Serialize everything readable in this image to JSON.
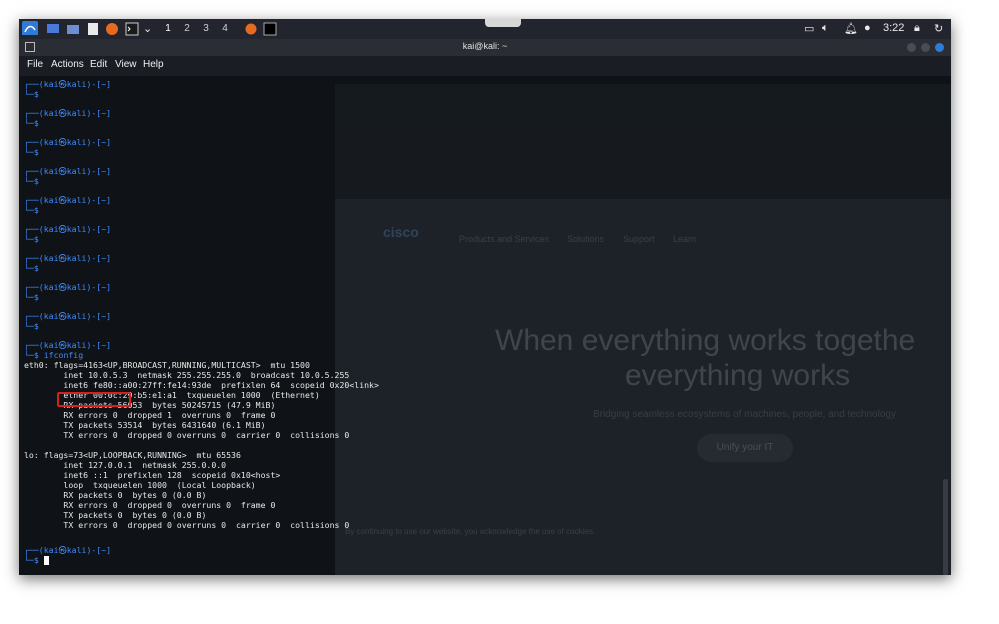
{
  "panel": {
    "workspaces": [
      "1",
      "2",
      "3",
      "4"
    ],
    "clock": "3:22"
  },
  "window": {
    "title": "kai@kali: ~"
  },
  "menu": [
    "File",
    "Actions",
    "Edit",
    "View",
    "Help"
  ],
  "prompt": {
    "user_host_start": "┌──(",
    "user": "kai",
    "at": "㉿",
    "host": "kali",
    "dir_part": ")-[~]",
    "second": "└─$"
  },
  "command": "ifconfig",
  "output": {
    "eth0": [
      "eth0: flags=4163<UP,BROADCAST,RUNNING,MULTICAST>  mtu 1500",
      "        inet 10.0.5.3  netmask 255.255.255.0  broadcast 10.0.5.255",
      "        inet6 fe80::a00:27ff:fe14:93de  prefixlen 64  scopeid 0x20<link>",
      "        ether 00:0c:29:b5:e1:a1  txqueuelen 1000  (Ethernet)",
      "        RX packets 56053  bytes 50245715 (47.9 MiB)",
      "        RX errors 0  dropped 1  overruns 0  frame 0",
      "        TX packets 53514  bytes 6431640 (6.1 MiB)",
      "        TX errors 0  dropped 0 overruns 0  carrier 0  collisions 0"
    ],
    "lo": [
      "lo: flags=73<UP,LOOPBACK,RUNNING>  mtu 65536",
      "        inet 127.0.0.1  netmask 255.0.0.0",
      "        inet6 ::1  prefixlen 128  scopeid 0x10<host>",
      "        loop  txqueuelen 1000  (Local Loopback)",
      "        RX packets 0  bytes 0 (0.0 B)",
      "        RX errors 0  dropped 0  overruns 0  frame 0",
      "        TX packets 0  bytes 0 (0.0 B)",
      "        TX errors 0  dropped 0 overruns 0  carrier 0  collisions 0"
    ]
  },
  "background_page": {
    "logo": "cisco",
    "nav": [
      "Products and Services",
      "Solutions",
      "Support",
      "Learn"
    ],
    "headline1": "When everything works togethe",
    "headline2": "everything works",
    "sub": "Bridging seamless ecosystems of machines, people, and technology",
    "button": "Unify your IT",
    "cookie": "By continuing to use our website, you acknowledge the use of cookies."
  },
  "colors": {
    "prompt_blue": "#3f8cff",
    "highlight": "#d8201a"
  }
}
